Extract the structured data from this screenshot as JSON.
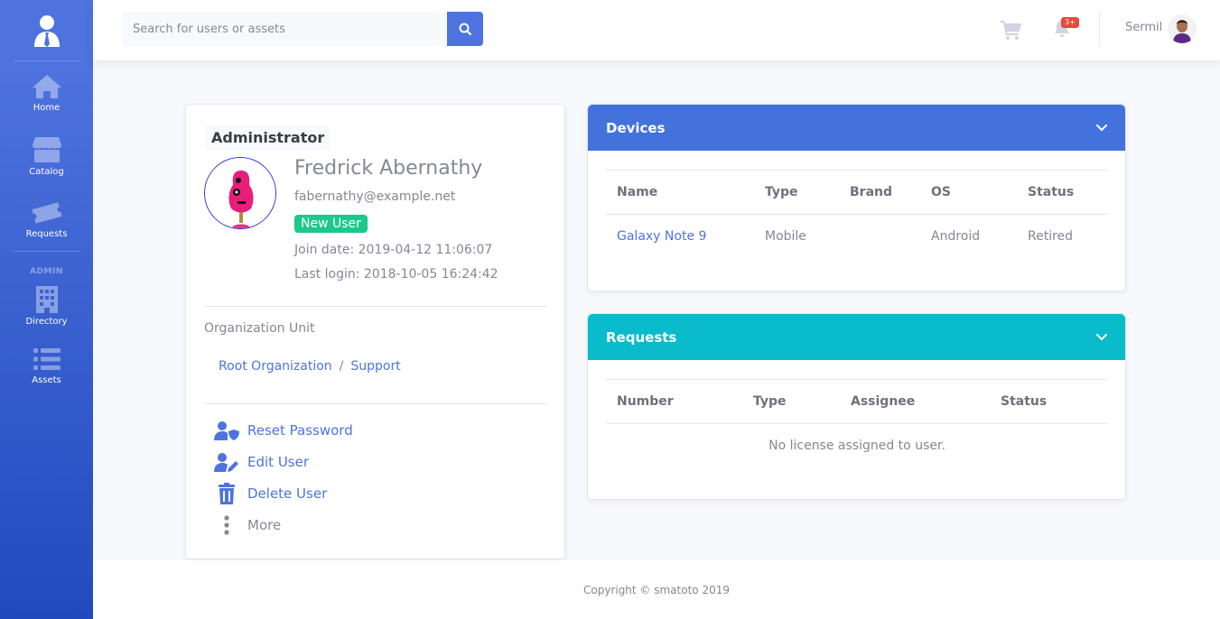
{
  "sidebar": {
    "brand_icon": "user-tie-icon",
    "items": [
      {
        "label": "Home",
        "icon": "home-icon"
      },
      {
        "label": "Catalog",
        "icon": "store-icon"
      },
      {
        "label": "Requests",
        "icon": "ticket-icon"
      }
    ],
    "heading": "ADMIN",
    "admin_items": [
      {
        "label": "Directory",
        "icon": "building-icon"
      },
      {
        "label": "Assets",
        "icon": "list-icon"
      }
    ]
  },
  "topbar": {
    "search_placeholder": "Search for users or assets",
    "notification_count": "3+",
    "username": "Sermil"
  },
  "profile": {
    "role": "Administrator",
    "name": "Fredrick Abernathy",
    "email": "fabernathy@example.net",
    "badge": "New User",
    "join_date": "Join date: 2019-04-12 11:06:07",
    "last_login": "Last login: 2018-10-05 16:24:42",
    "org_title": "Organization Unit",
    "org_path": [
      "Root Organization",
      "Support"
    ],
    "org_separator": "/",
    "actions": {
      "reset": "Reset Password",
      "edit": "Edit User",
      "delete": "Delete User",
      "more": "More"
    }
  },
  "devices": {
    "title": "Devices",
    "columns": [
      "Name",
      "Type",
      "Brand",
      "OS",
      "Status"
    ],
    "rows": [
      {
        "name": "Galaxy Note 9",
        "type": "Mobile",
        "brand": "",
        "os": "Android",
        "status": "Retired"
      }
    ]
  },
  "requests": {
    "title": "Requests",
    "columns": [
      "Number",
      "Type",
      "Assignee",
      "Status"
    ],
    "empty": "No license assigned to user."
  },
  "footer": {
    "text": "Copyright © smatoto 2019"
  },
  "colors": {
    "primary": "#4e73df",
    "info": "#09bbcb",
    "success": "#1cc88a",
    "danger": "#e74a3b"
  }
}
